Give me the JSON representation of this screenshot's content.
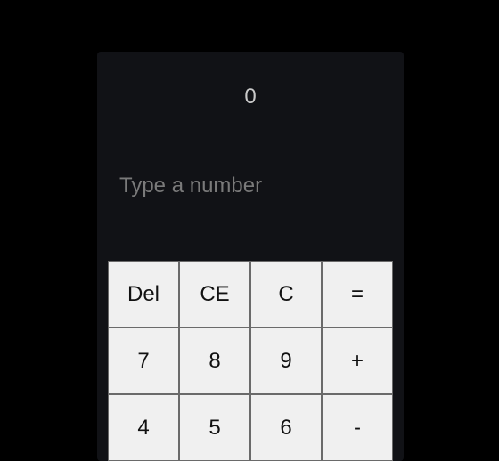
{
  "display": {
    "value": "0"
  },
  "input": {
    "placeholder": "Type a number",
    "value": ""
  },
  "keypad": {
    "keys": [
      {
        "label": "Del"
      },
      {
        "label": "CE"
      },
      {
        "label": "C"
      },
      {
        "label": "="
      },
      {
        "label": "7"
      },
      {
        "label": "8"
      },
      {
        "label": "9"
      },
      {
        "label": "+"
      },
      {
        "label": "4"
      },
      {
        "label": "5"
      },
      {
        "label": "6"
      },
      {
        "label": "-"
      }
    ]
  },
  "colors": {
    "page_background": "#000000",
    "panel_background": "#111216",
    "key_background": "#f0f0f0",
    "display_text": "#c9c9c9",
    "placeholder_text": "#7a7a7a"
  }
}
